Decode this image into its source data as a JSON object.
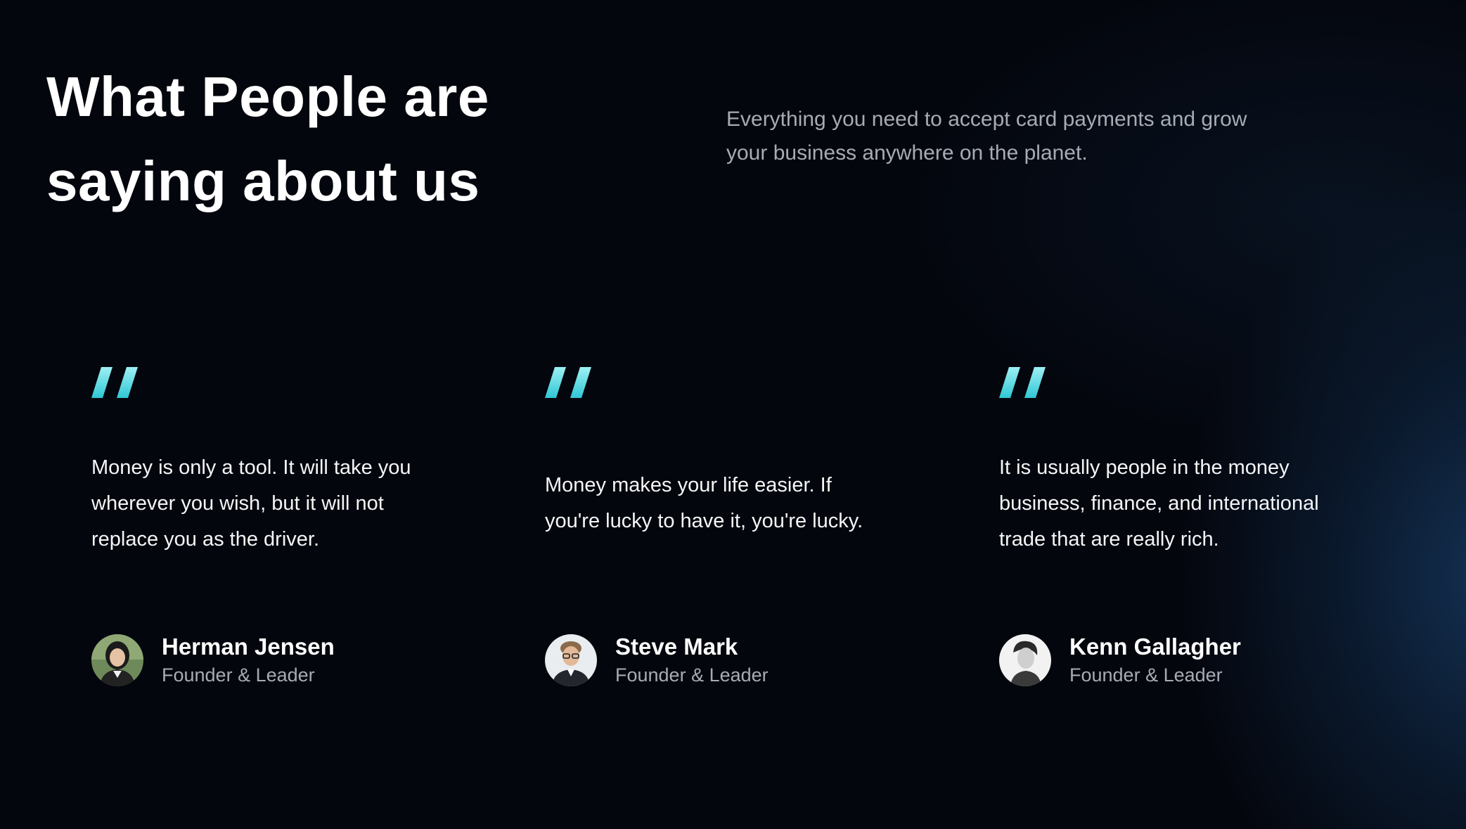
{
  "section": {
    "heading": "What People are saying about us",
    "intro": "Everything you need to accept card payments and grow your business anywhere on the planet."
  },
  "theme": {
    "background": "#04060d",
    "accent_gradient_start": "#2fc7d4",
    "accent_gradient_end": "#9ef0f4",
    "muted_text": "#a7abb3"
  },
  "testimonials": [
    {
      "quote_icon": "quote-icon",
      "text": "Money is only a tool. It will take you wherever you wish, but it will not replace you as the driver.",
      "name": "Herman Jensen",
      "role": "Founder & Leader",
      "avatar_icon": "avatar-photo"
    },
    {
      "quote_icon": "quote-icon",
      "text": "Money makes your life easier. If you're lucky to have it, you're lucky.",
      "name": "Steve Mark",
      "role": "Founder & Leader",
      "avatar_icon": "avatar-photo"
    },
    {
      "quote_icon": "quote-icon",
      "text": "It is usually people in the money business, finance, and international trade that are really rich.",
      "name": "Kenn Gallagher",
      "role": "Founder & Leader",
      "avatar_icon": "avatar-photo"
    }
  ]
}
